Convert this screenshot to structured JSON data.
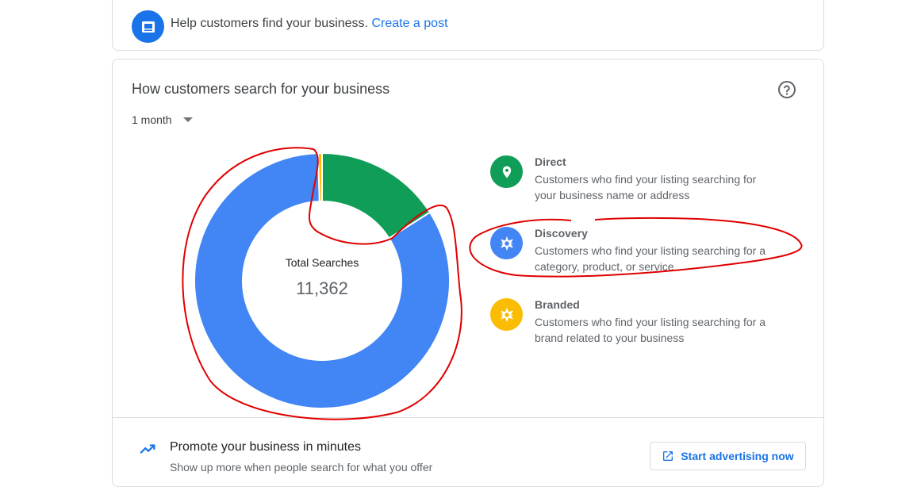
{
  "post_prompt": {
    "text": "Help customers find your business.",
    "link": "Create a post",
    "icon": "post-icon"
  },
  "search_card": {
    "title": "How customers search for your business",
    "help_icon": "help-circle-icon",
    "period": "1 month",
    "total_label": "Total Searches",
    "total_value": "11,362",
    "legend": [
      {
        "label": "Direct",
        "description": "Customers who find your listing searching for your business name or address",
        "color": "#0f9d58",
        "icon": "location-pin-icon"
      },
      {
        "label": "Discovery",
        "description": "Customers who find your listing searching for a category, product, or service",
        "color": "#4285f4",
        "icon": "compass-icon"
      },
      {
        "label": "Branded",
        "description": "Customers who find your listing searching for a brand related to your business",
        "color": "#fbbc04",
        "icon": "compass-icon"
      }
    ]
  },
  "chart_data": {
    "type": "pie",
    "categories": [
      "Direct",
      "Discovery",
      "Branded"
    ],
    "values": [
      0.16,
      0.835,
      0.005
    ],
    "colors": [
      "#0f9d58",
      "#4285f4",
      "#fbbc04"
    ],
    "donut": true
  },
  "promo": {
    "title": "Promote your business in minutes",
    "subtitle": "Show up more when people search for what you offer",
    "button": "Start advertising now",
    "icon": "trending-up-icon",
    "button_icon": "open-external-icon"
  },
  "colors": {
    "accent": "#1a73e8",
    "annotation": "#e00000"
  }
}
